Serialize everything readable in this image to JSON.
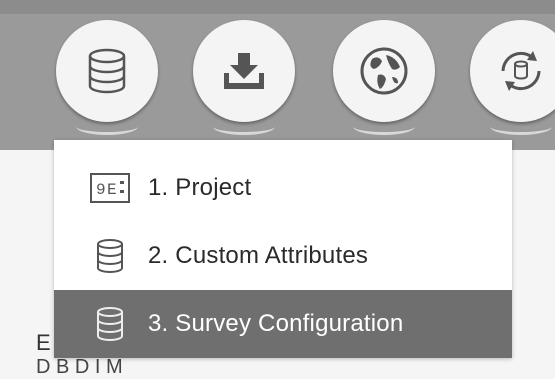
{
  "toolbar": {
    "buttons": [
      {
        "icon": "database-icon"
      },
      {
        "icon": "download-icon"
      },
      {
        "icon": "globe-icon"
      },
      {
        "icon": "sync-icon"
      }
    ]
  },
  "menu": {
    "items": [
      {
        "label": "1. Project",
        "icon": "project-icon"
      },
      {
        "label": "2. Custom Attributes",
        "icon": "database-icon"
      },
      {
        "label": "3. Survey Configuration",
        "icon": "database-icon",
        "selected": true
      }
    ]
  },
  "background": {
    "partial_line_1": "E",
    "partial_line_2": "D      B     D    I   M"
  },
  "colors": {
    "toolbar_bg": "#9a9a9a",
    "selected_bg": "#6f6f6f"
  }
}
